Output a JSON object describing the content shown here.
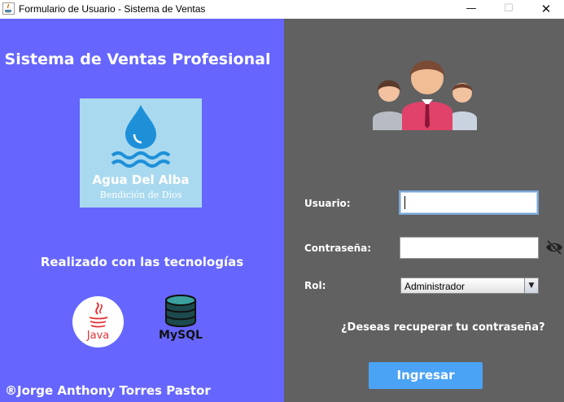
{
  "window": {
    "title": "Formulario de Usuario - Sistema de Ventas",
    "minimize": "—",
    "maximize": "☐",
    "close": "✕"
  },
  "left_panel": {
    "title": "Sistema de Ventas Profesional",
    "logo": {
      "name": "Agua Del Alba",
      "subtitle": "Bendición de Dios"
    },
    "tech_label": "Realizado con las tecnologías",
    "java_text": "Java",
    "mysql_text": "MySQL",
    "author": "®Jorge Anthony Torres Pastor"
  },
  "form": {
    "user_label": "Usuario:",
    "user_value": "",
    "password_label": "Contraseña:",
    "password_value": "",
    "role_label": "Rol:",
    "role_selected": "Administrador",
    "recover_link": "¿Deseas recuperar tu contraseña?",
    "submit_label": "Ingresar"
  },
  "colors": {
    "left_bg": "#6666ff",
    "right_bg": "#616161",
    "button_bg": "#4aa3f5"
  }
}
